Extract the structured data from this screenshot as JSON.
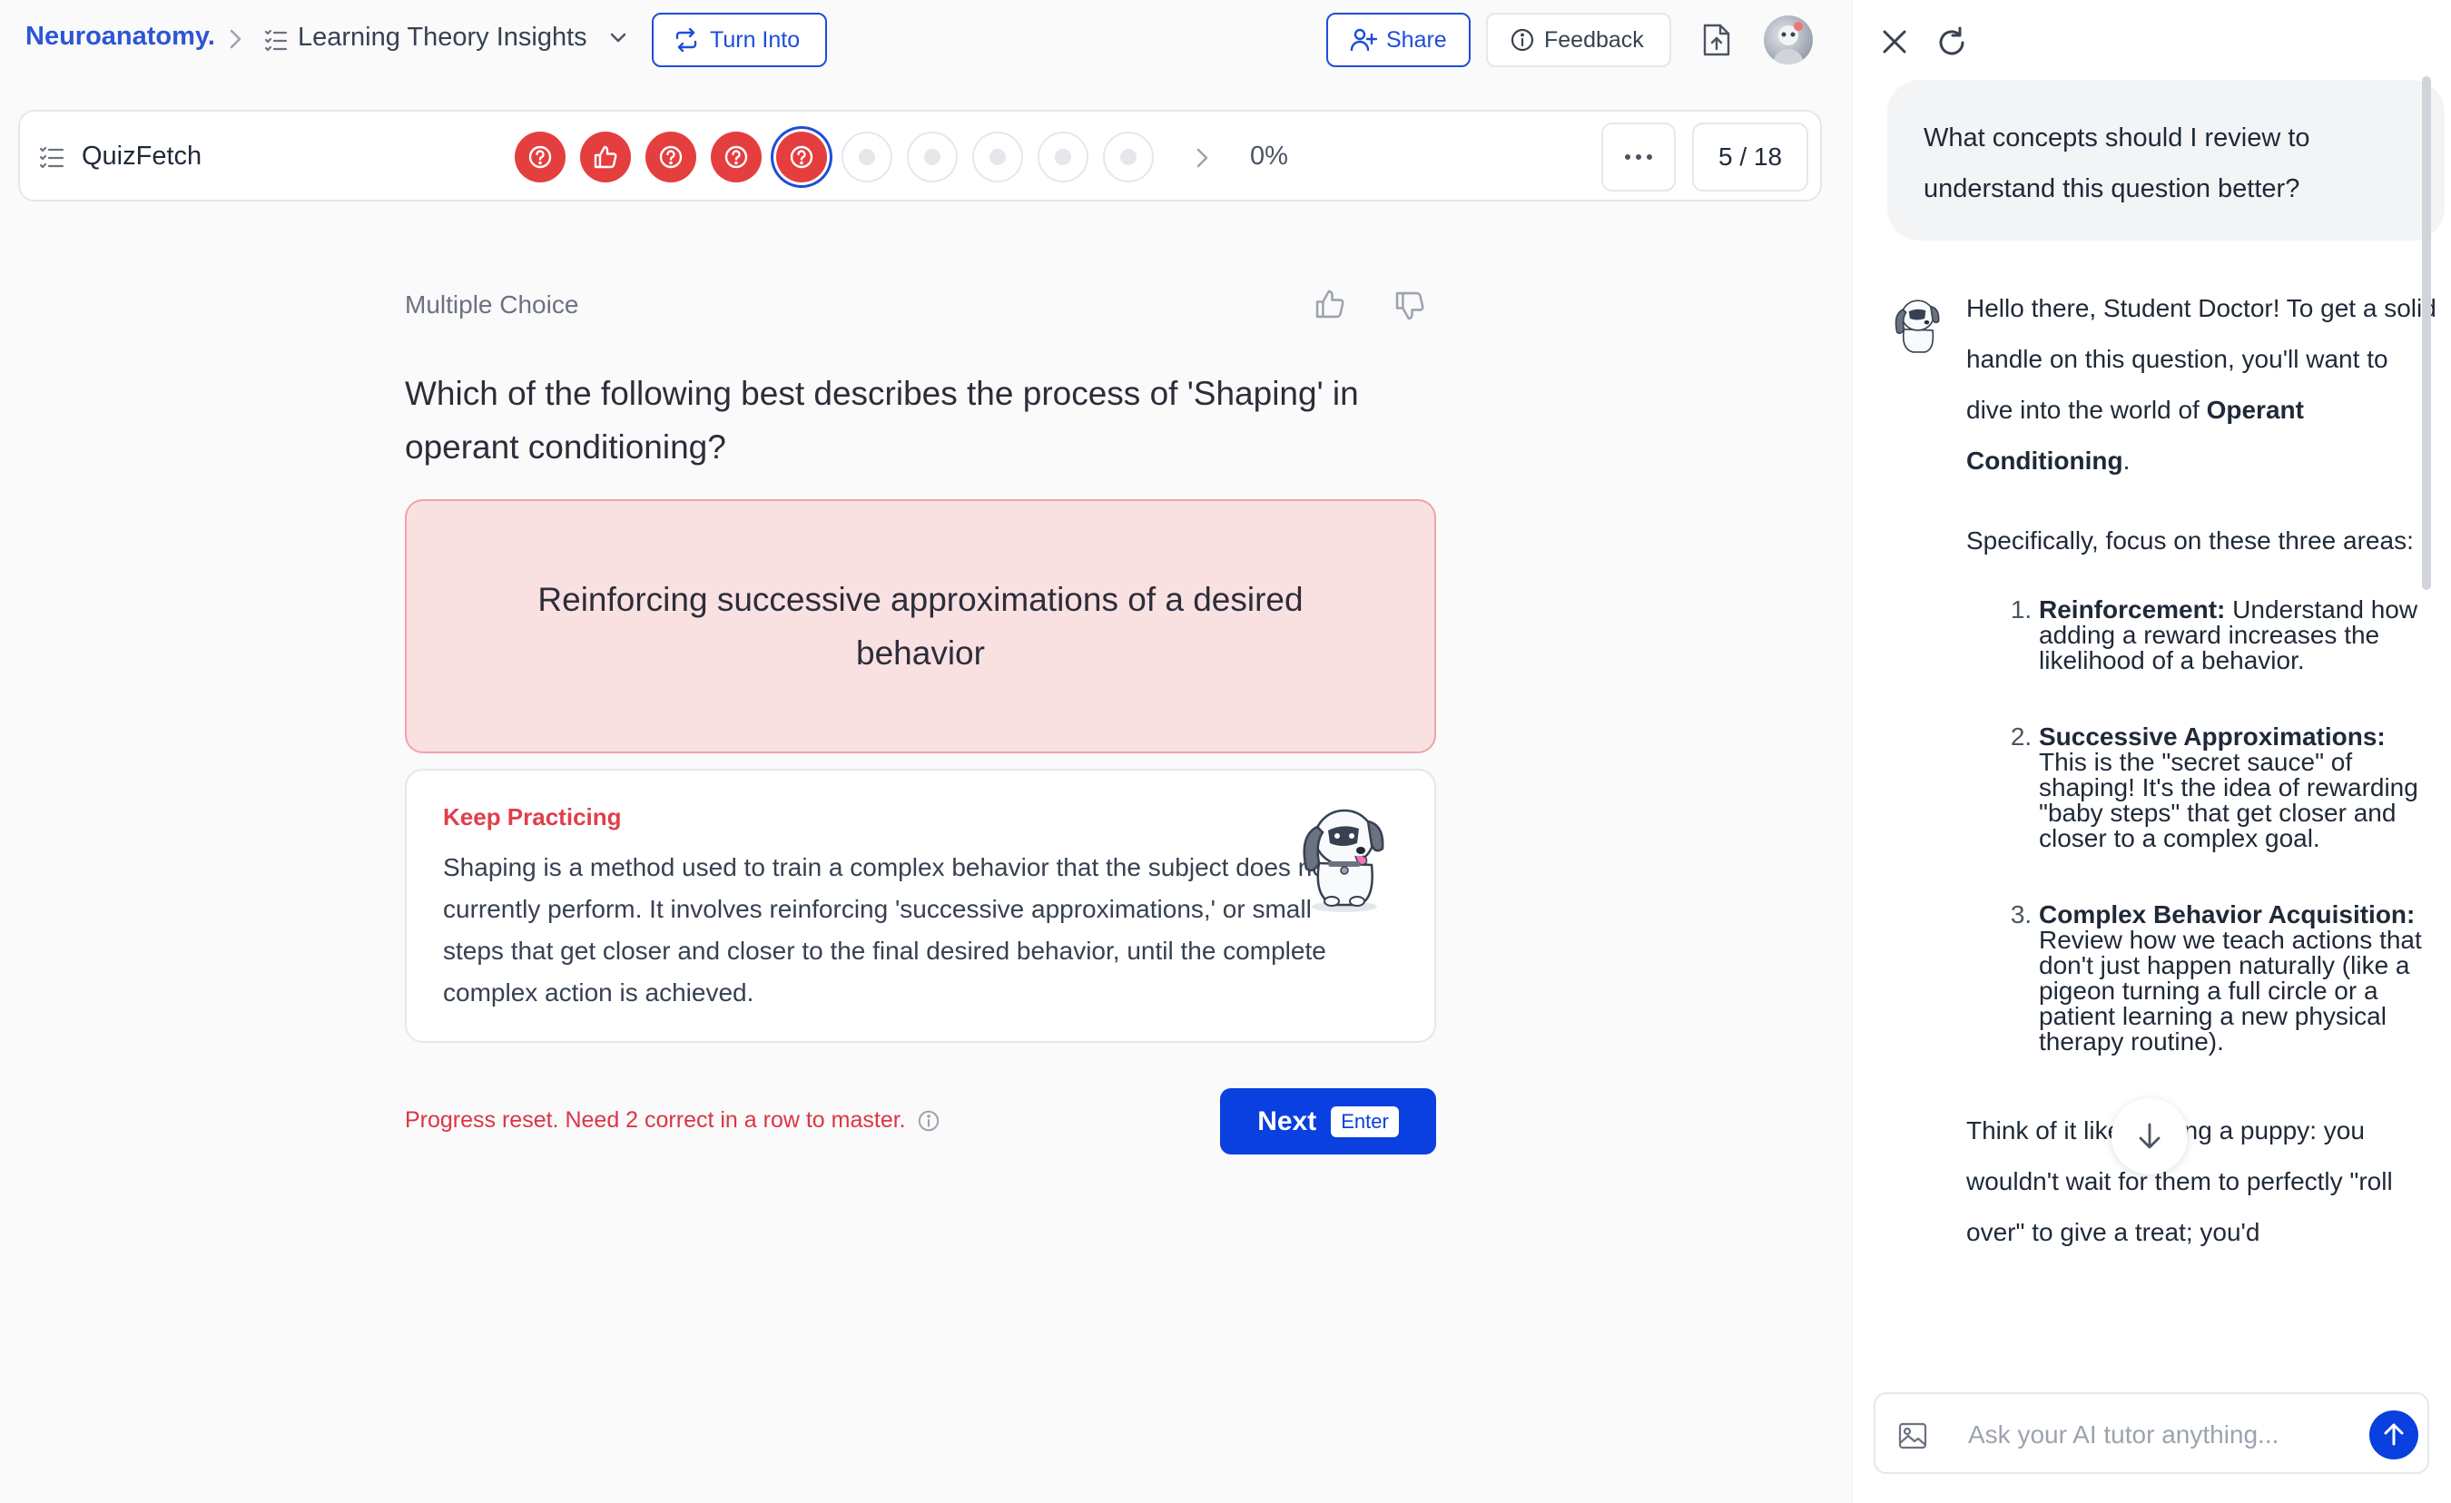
{
  "header": {
    "brand": "Neuroanatomy.",
    "title": "Learning Theory Insights",
    "turn_into_label": "Turn Into",
    "share_label": "Share",
    "feedback_label": "Feedback"
  },
  "quiz": {
    "name": "QuizFetch",
    "progress_pct": "0%",
    "counter": "5 / 18",
    "dots": [
      {
        "state": "incorrect",
        "icon": "question-icon"
      },
      {
        "state": "incorrect",
        "icon": "thumbs-up-icon"
      },
      {
        "state": "incorrect",
        "icon": "question-icon"
      },
      {
        "state": "incorrect",
        "icon": "question-icon"
      },
      {
        "state": "current",
        "icon": "question-icon"
      },
      {
        "state": "unanswered"
      },
      {
        "state": "unanswered"
      },
      {
        "state": "unanswered"
      },
      {
        "state": "unanswered"
      },
      {
        "state": "unanswered"
      }
    ]
  },
  "question": {
    "type_label": "Multiple Choice",
    "text": "Which of the following best describes the process of 'Shaping' in operant conditioning?",
    "answer": "Reinforcing successive approximations of a desired behavior",
    "feedback_title": "Keep Practicing",
    "feedback_text": "Shaping is a method used to train a complex behavior that the subject does not currently perform. It involves reinforcing 'successive approximations,' or small steps that get closer and closer to the final desired behavior, until the complete complex action is achieved.",
    "progress_message": "Progress reset. Need 2 correct in a row to master.",
    "next_label": "Next",
    "next_key": "Enter"
  },
  "chat": {
    "user_message": "What concepts should I review to understand this question better?",
    "reply": {
      "intro": "Hello there, Student Doctor! To get a solid handle on this question, you'll want to dive into the world of ",
      "intro_bold": "Operant Conditioning",
      "intro_end": ".",
      "focus": "Specifically, focus on these three areas:",
      "items": [
        {
          "title": "Reinforcement:",
          "text": " Understand how adding a reward increases the likelihood of a behavior."
        },
        {
          "title": "Successive Approximations:",
          "text": " This is the \"secret sauce\" of shaping! It's the idea of rewarding \"baby steps\" that get closer and closer to a complex goal."
        },
        {
          "title": "Complex Behavior Acquisition:",
          "text": " Review how we teach actions that don't just happen naturally (like a pigeon turning a full circle or a patient learning a new physical therapy routine)."
        }
      ],
      "outro": "Think of it like training a puppy: you wouldn't wait for them to perfectly \"roll over\" to give a treat; you'd"
    },
    "input_placeholder": "Ask your AI tutor anything..."
  },
  "colors": {
    "accent": "#0a3fe0",
    "incorrect": "#e53e3e",
    "answer_bg": "#f9e1e2"
  }
}
